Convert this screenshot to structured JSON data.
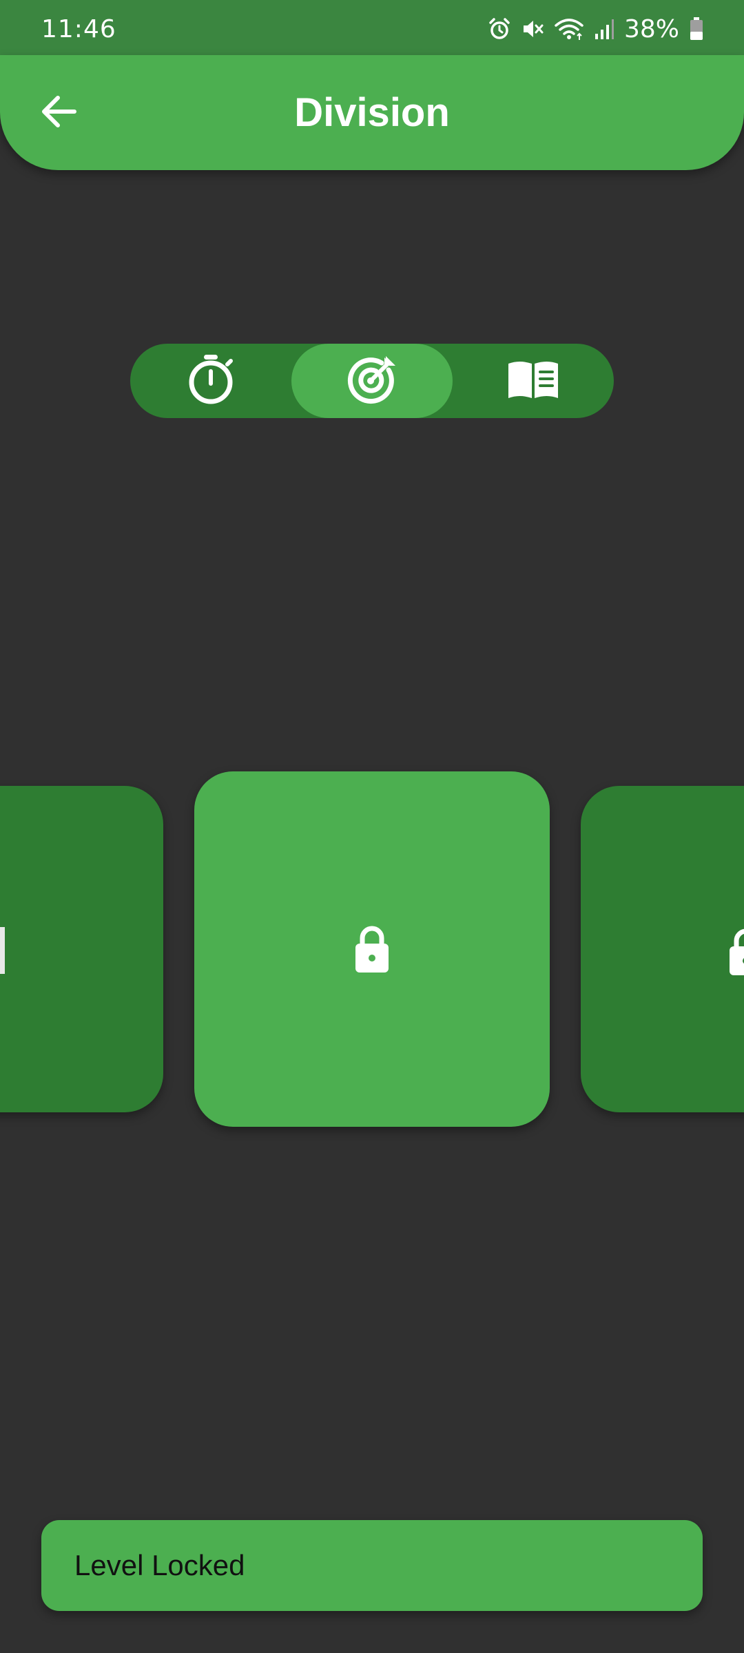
{
  "status_bar": {
    "time": "11:46",
    "battery_percent": "38%",
    "icons": [
      "alarm-icon",
      "mute-icon",
      "wifi-icon",
      "signal-icon",
      "battery-icon"
    ],
    "background_color": "#3b8640"
  },
  "app_bar": {
    "title": "Division",
    "back_icon": "arrow-back-icon",
    "background_color": "#4caf50"
  },
  "mode_selector": {
    "tabs": [
      {
        "icon": "stopwatch-icon",
        "active": false
      },
      {
        "icon": "target-icon",
        "active": true
      },
      {
        "icon": "open-book-icon",
        "active": false
      }
    ],
    "track_color": "#2e7d32",
    "active_color": "#4caf50"
  },
  "levels": [
    {
      "position": "previous",
      "icon": "partial-level-mark",
      "locked": false
    },
    {
      "position": "current",
      "icon": "lock-icon",
      "locked": true
    },
    {
      "position": "next",
      "icon": "lock-icon",
      "locked": true
    }
  ],
  "bottom_bar": {
    "label": "Level Locked"
  },
  "colors": {
    "background": "#303030",
    "accent": "#4caf50",
    "accent_dark": "#2e7d32",
    "icon": "#ffffff"
  }
}
